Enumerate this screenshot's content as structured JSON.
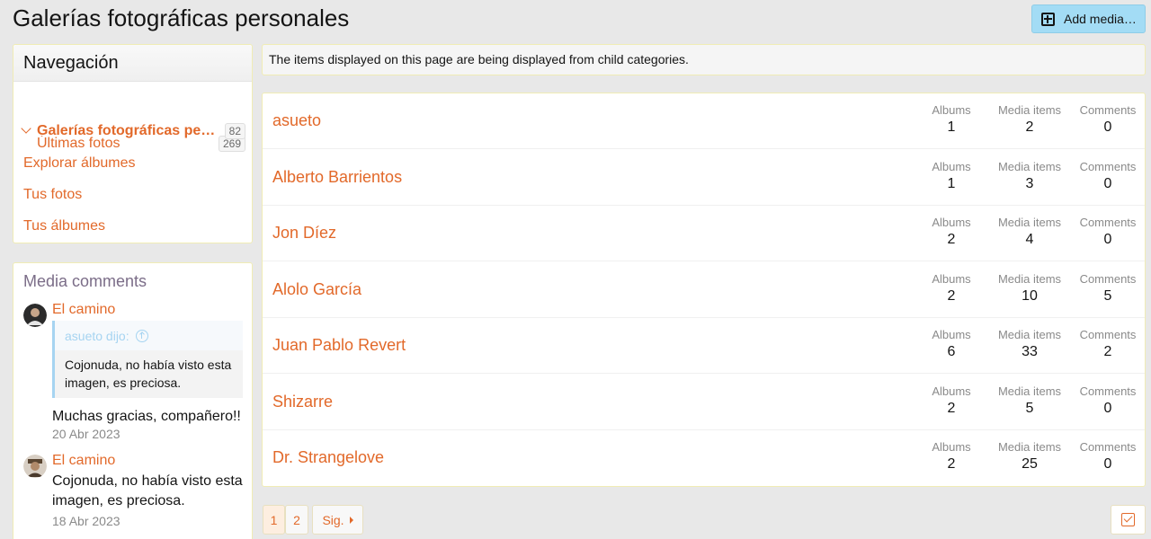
{
  "header": {
    "title": "Galerías fotográficas personales",
    "add_media_label": "Add media…"
  },
  "navigation": {
    "title": "Navegación",
    "items": [
      {
        "label": "Últimas fotos",
        "count": "269"
      },
      {
        "label": "Galerías fotográficas personales",
        "count": "82"
      },
      {
        "label": "Explorar álbumes"
      },
      {
        "label": "Tus fotos"
      },
      {
        "label": "Tus álbumes"
      }
    ]
  },
  "media_comments": {
    "title": "Media comments",
    "items": [
      {
        "author": "El camino",
        "quote_author": "asueto dijo:",
        "quote_text": "Cojonuda, no había visto esta imagen, es preciosa.",
        "text": "Muchas gracias, compañero!!",
        "date": "20 Abr 2023"
      },
      {
        "author": "El camino",
        "text": "Cojonuda, no había visto esta imagen, es preciosa.",
        "date": "18 Abr 2023"
      }
    ]
  },
  "notice": "The items displayed on this page are being displayed from child categories.",
  "stat_labels": {
    "albums": "Albums",
    "media": "Media items",
    "comments": "Comments"
  },
  "categories": [
    {
      "name": "asueto",
      "albums": "1",
      "media": "2",
      "comments": "0"
    },
    {
      "name": "Alberto Barrientos",
      "albums": "1",
      "media": "3",
      "comments": "0"
    },
    {
      "name": "Jon Díez",
      "albums": "2",
      "media": "4",
      "comments": "0"
    },
    {
      "name": "Alolo García",
      "albums": "2",
      "media": "10",
      "comments": "5"
    },
    {
      "name": "Juan Pablo Revert",
      "albums": "6",
      "media": "33",
      "comments": "2"
    },
    {
      "name": "Shizarre",
      "albums": "2",
      "media": "5",
      "comments": "0"
    },
    {
      "name": "Dr. Strangelove",
      "albums": "2",
      "media": "25",
      "comments": "0"
    }
  ],
  "pagination": {
    "pages": [
      "1",
      "2"
    ],
    "current": "1",
    "next_label": "Sig."
  },
  "colors": {
    "accent": "#e2692a",
    "button": "#a3dcf5",
    "border": "#f0ecb5"
  }
}
